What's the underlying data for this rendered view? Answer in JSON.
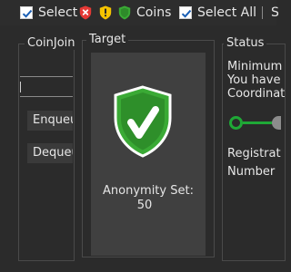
{
  "selection_bar": {
    "select_label": "Select",
    "coins_label": "Coins",
    "select_all_label": "Select All",
    "trailing_label": "S",
    "colors": {
      "red_shield": "#e53935",
      "yellow_shield": "#f5c400",
      "green_shield": "#3aaa35"
    }
  },
  "coinjoin_group": {
    "title": "CoinJoin",
    "enqueue_label": "Enqueue",
    "dequeue_label": "Dequeue"
  },
  "target_group": {
    "title": "Target",
    "anonymity_label": "Anonymity Set:",
    "anonymity_value": "50",
    "shield_color": "#3aaa35"
  },
  "status_group": {
    "title": "Status",
    "line1": "Minimum",
    "line2": "You have",
    "line3": "Coordinat",
    "line4": "Registrat",
    "line5": "Number",
    "phase_color": "#1fa836"
  }
}
